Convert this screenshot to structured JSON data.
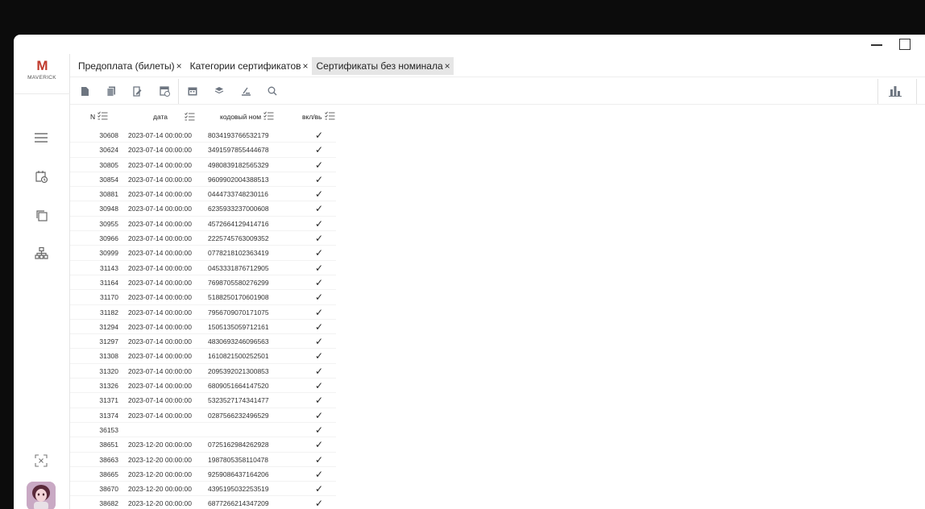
{
  "app": {
    "logo_mark": "M",
    "logo_text": "MAVERICK"
  },
  "tabs": [
    {
      "label": "Предоплата (билеты)",
      "close": "×",
      "active": false
    },
    {
      "label": "Категории сертификатов",
      "close": "×",
      "active": false
    },
    {
      "label": "Сертификаты без номинала",
      "close": "×",
      "active": true
    }
  ],
  "grid": {
    "columns": [
      {
        "key": "n",
        "label": "N"
      },
      {
        "key": "date",
        "label": "дата"
      },
      {
        "key": "code",
        "label": "кодовый ном"
      },
      {
        "key": "enabled",
        "label": "вкл/вь"
      }
    ],
    "rows": [
      {
        "n": "30608",
        "date": "2023-07-14 00:00:00",
        "code": "8034193766532179",
        "enabled": "✓"
      },
      {
        "n": "30624",
        "date": "2023-07-14 00:00:00",
        "code": "3491597855444678",
        "enabled": "✓"
      },
      {
        "n": "30805",
        "date": "2023-07-14 00:00:00",
        "code": "4980839182565329",
        "enabled": "✓"
      },
      {
        "n": "30854",
        "date": "2023-07-14 00:00:00",
        "code": "9609902004388513",
        "enabled": "✓"
      },
      {
        "n": "30881",
        "date": "2023-07-14 00:00:00",
        "code": "0444733748230116",
        "enabled": "✓"
      },
      {
        "n": "30948",
        "date": "2023-07-14 00:00:00",
        "code": "6235933237000608",
        "enabled": "✓"
      },
      {
        "n": "30955",
        "date": "2023-07-14 00:00:00",
        "code": "4572664129414716",
        "enabled": "✓"
      },
      {
        "n": "30966",
        "date": "2023-07-14 00:00:00",
        "code": "2225745763009352",
        "enabled": "✓"
      },
      {
        "n": "30999",
        "date": "2023-07-14 00:00:00",
        "code": "0778218102363419",
        "enabled": "✓"
      },
      {
        "n": "31143",
        "date": "2023-07-14 00:00:00",
        "code": "0453331876712905",
        "enabled": "✓"
      },
      {
        "n": "31164",
        "date": "2023-07-14 00:00:00",
        "code": "7698705580276299",
        "enabled": "✓"
      },
      {
        "n": "31170",
        "date": "2023-07-14 00:00:00",
        "code": "5188250170601908",
        "enabled": "✓"
      },
      {
        "n": "31182",
        "date": "2023-07-14 00:00:00",
        "code": "7956709070171075",
        "enabled": "✓"
      },
      {
        "n": "31294",
        "date": "2023-07-14 00:00:00",
        "code": "1505135059712161",
        "enabled": "✓"
      },
      {
        "n": "31297",
        "date": "2023-07-14 00:00:00",
        "code": "4830693246096563",
        "enabled": "✓"
      },
      {
        "n": "31308",
        "date": "2023-07-14 00:00:00",
        "code": "1610821500252501",
        "enabled": "✓"
      },
      {
        "n": "31320",
        "date": "2023-07-14 00:00:00",
        "code": "2095392021300853",
        "enabled": "✓"
      },
      {
        "n": "31326",
        "date": "2023-07-14 00:00:00",
        "code": "6809051664147520",
        "enabled": "✓"
      },
      {
        "n": "31371",
        "date": "2023-07-14 00:00:00",
        "code": "5323527174341477",
        "enabled": "✓"
      },
      {
        "n": "31374",
        "date": "2023-07-14 00:00:00",
        "code": "0287566232496529",
        "enabled": "✓"
      },
      {
        "n": "36153",
        "date": "",
        "code": "",
        "enabled": "✓"
      },
      {
        "n": "38651",
        "date": "2023-12-20 00:00:00",
        "code": "0725162984262928",
        "enabled": "✓"
      },
      {
        "n": "38663",
        "date": "2023-12-20 00:00:00",
        "code": "1987805358110478",
        "enabled": "✓"
      },
      {
        "n": "38665",
        "date": "2023-12-20 00:00:00",
        "code": "9259086437164206",
        "enabled": "✓"
      },
      {
        "n": "38670",
        "date": "2023-12-20 00:00:00",
        "code": "4395195032253519",
        "enabled": "✓"
      },
      {
        "n": "38682",
        "date": "2023-12-20 00:00:00",
        "code": "6877266214347209",
        "enabled": "✓"
      }
    ]
  },
  "colors": {
    "logo_accent": "#c0392b",
    "active_tab": "#e6e6e6"
  }
}
